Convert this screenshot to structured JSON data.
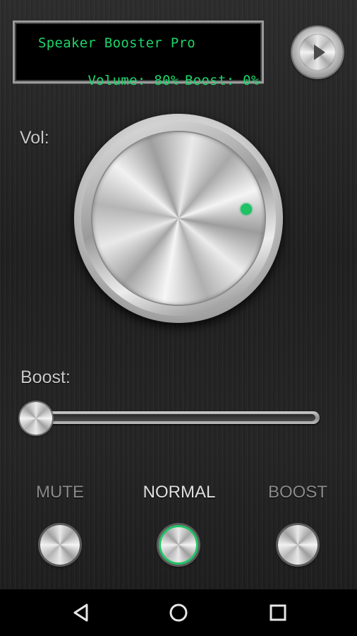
{
  "display": {
    "title": "Speaker Booster Pro",
    "volume_text": "Volume: 80%",
    "boost_text": "Boost: 0%"
  },
  "play_button": {
    "icon": "play-icon"
  },
  "volume": {
    "label": "Vol:",
    "level": 0.8,
    "indicator_color": "#1fc264"
  },
  "boost": {
    "label": "Boost:",
    "level": 0.0
  },
  "modes": [
    {
      "label": "MUTE",
      "active": false
    },
    {
      "label": "NORMAL",
      "active": true
    },
    {
      "label": "BOOST",
      "active": false
    }
  ],
  "colors": {
    "lcd_text": "#1ed46a",
    "accent": "#1fc264",
    "label_inactive": "#8a8a8a",
    "label_active": "#e0e0e0"
  },
  "navbar": {
    "icons": [
      "back-icon",
      "home-icon",
      "recents-icon"
    ]
  }
}
